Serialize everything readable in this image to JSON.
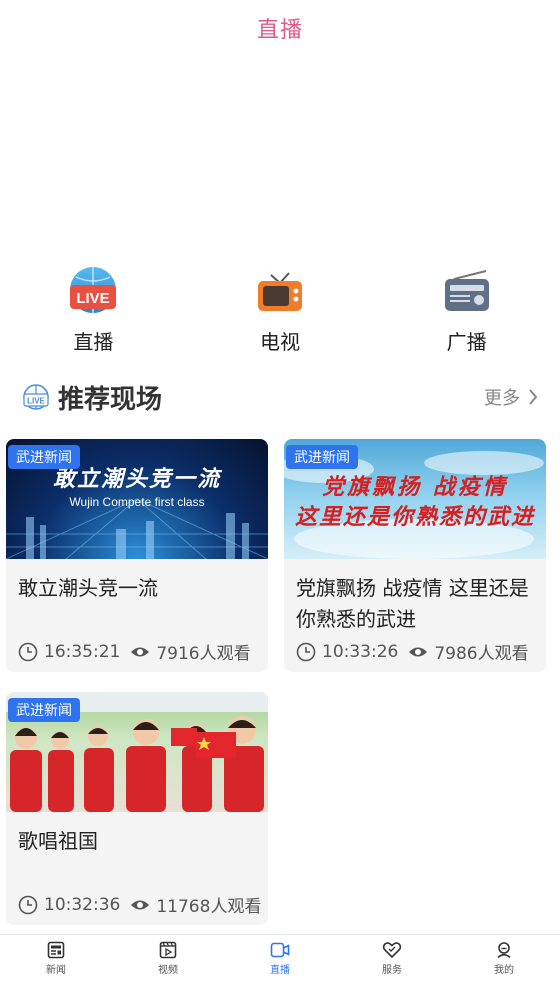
{
  "header": {
    "title": "直播"
  },
  "entries": [
    {
      "label": "直播",
      "icon": "live-globe-icon"
    },
    {
      "label": "电视",
      "icon": "tv-icon"
    },
    {
      "label": "广播",
      "icon": "radio-icon"
    }
  ],
  "section": {
    "title": "推荐现场",
    "more": "更多",
    "icon": "live-globe-icon"
  },
  "cards": [
    {
      "tag": "武进新闻",
      "title": "敢立潮头竞一流",
      "time": "16:35:21",
      "views": "7916人观看",
      "thumb_line1": "敢立潮头竞一流",
      "thumb_line2": "Wujin Compete first class"
    },
    {
      "tag": "武进新闻",
      "title": "党旗飘扬 战疫情 这里还是你熟悉的武进",
      "time": "10:33:26",
      "views": "7986人观看",
      "thumb_line1": "党旗飘扬  战疫情",
      "thumb_line2": "这里还是你熟悉的武进"
    },
    {
      "tag": "武进新闻",
      "title": "歌唱祖国",
      "time": "10:32:36",
      "views": "11768人观看"
    }
  ],
  "tabbar": [
    {
      "label": "新闻",
      "icon": "news-icon",
      "active": false
    },
    {
      "label": "视频",
      "icon": "video-icon",
      "active": false
    },
    {
      "label": "直播",
      "icon": "live-camera-icon",
      "active": true
    },
    {
      "label": "服务",
      "icon": "heart-service-icon",
      "active": false
    },
    {
      "label": "我的",
      "icon": "profile-icon",
      "active": false
    }
  ],
  "colors": {
    "accent_title": "#e05a8c",
    "tag_blue": "#2f74ee",
    "active_tab": "#2f74ee"
  }
}
